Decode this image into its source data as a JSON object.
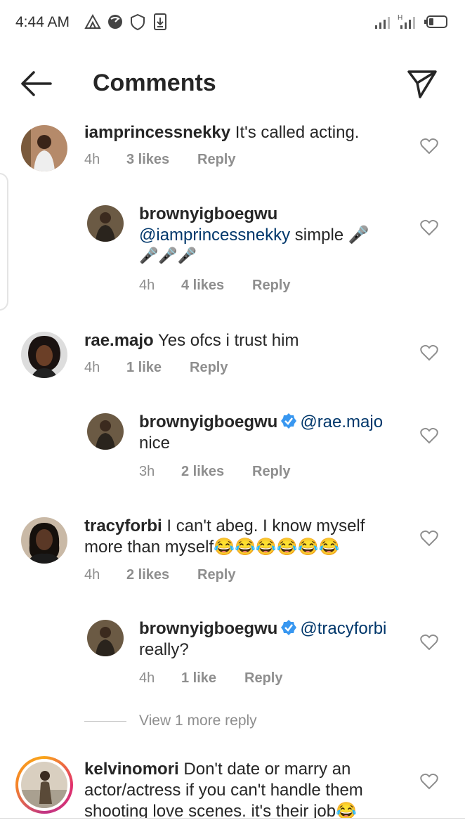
{
  "status_bar": {
    "time": "4:44 AM",
    "left_icons": [
      "delta-icon",
      "speedometer-icon",
      "shield-icon",
      "download-icon"
    ],
    "right_icons": [
      "signal-icon",
      "signal-hd-icon",
      "battery-icon"
    ]
  },
  "header": {
    "title": "Comments",
    "back_icon": "arrow-left-icon",
    "share_icon": "send-icon"
  },
  "comments": [
    {
      "username": "iamprincessnekky",
      "text": " It's called acting.",
      "time": "4h",
      "likes": "3 likes",
      "reply": "Reply"
    },
    {
      "username": "brownyigboegwu",
      "mention": "@iamprincessnekky",
      "text": " simple 🎤",
      "text_line2": "🎤🎤🎤",
      "time": "4h",
      "likes": "4 likes",
      "reply": "Reply"
    },
    {
      "username": "rae.majo",
      "text": " Yes ofcs i trust him",
      "time": "4h",
      "likes": "1 like",
      "reply": "Reply"
    },
    {
      "username": "brownyigboegwu",
      "verified": true,
      "mention": "@rae.majo",
      "text_line2": "nice",
      "time": "3h",
      "likes": "2 likes",
      "reply": "Reply"
    },
    {
      "username": "tracyforbi",
      "text": " I can't abeg. I know myself",
      "text_line2": "more than myself😂😂😂😂😂😂",
      "time": "4h",
      "likes": "2 likes",
      "reply": "Reply"
    },
    {
      "username": "brownyigboegwu",
      "verified": true,
      "mention": "@tracyforbi",
      "text_line2": "really?",
      "time": "4h",
      "likes": "1 like",
      "reply": "Reply"
    },
    {
      "username": "kelvinomori",
      "text": " Don't date or marry an",
      "text_line2": "actor/actress if you can't handle them",
      "text_line3": "shooting love scenes. it's their job😂"
    }
  ],
  "view_more_replies": "View 1 more reply",
  "colors": {
    "text": "#262626",
    "secondary": "#8e8e8e",
    "mention": "#00376b",
    "verified": "#3897f0"
  }
}
